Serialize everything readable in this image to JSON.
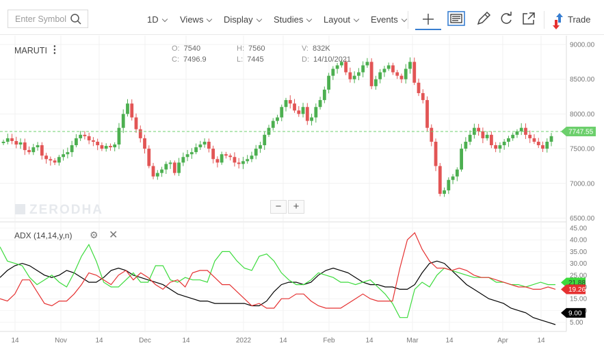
{
  "toolbar": {
    "search_placeholder": "Enter Symbol",
    "interval": "1D",
    "views": "Views",
    "display": "Display",
    "studies": "Studies",
    "layout": "Layout",
    "events": "Events",
    "trade": "Trade"
  },
  "header": {
    "symbol": "MARUTI",
    "o_label": "O:",
    "o_value": "7540",
    "c_label": "C:",
    "c_value": "7496.9",
    "h_label": "H:",
    "h_value": "7560",
    "l_label": "L:",
    "l_value": "7445",
    "v_label": "V:",
    "v_value": "832K",
    "date": "14/10/2021"
  },
  "watermark": "ZERODHA",
  "zoom": {
    "minus": "−",
    "plus": "+"
  },
  "indicator": {
    "label": "ADX (14,14,y,n)"
  },
  "colors": {
    "up": "#4caf50",
    "down": "#e25555",
    "adx": "#000000",
    "plus_di": "#3cdb3c",
    "minus_di": "#e53030",
    "last_price": "#6ccf6c"
  },
  "chart_data": [
    {
      "type": "candlestick",
      "symbol": "MARUTI",
      "ylim": [
        6500,
        9000
      ],
      "y_ticks": [
        "9000.00",
        "8500.00",
        "8000.00",
        "7500.00",
        "7000.00",
        "6500.00"
      ],
      "x_ticks": [
        "14",
        "Nov",
        "14",
        "Dec",
        "14",
        "2022",
        "14",
        "Feb",
        "14",
        "Mar",
        "14",
        "Apr",
        "14"
      ],
      "last_price": "7747.55",
      "close_series": [
        7600,
        7650,
        7610,
        7560,
        7590,
        7480,
        7450,
        7520,
        7550,
        7400,
        7350,
        7330,
        7300,
        7380,
        7420,
        7450,
        7550,
        7650,
        7700,
        7680,
        7620,
        7600,
        7550,
        7500,
        7540,
        7520,
        7560,
        7800,
        8000,
        8150,
        7950,
        7780,
        7650,
        7500,
        7250,
        7100,
        7150,
        7200,
        7280,
        7300,
        7150,
        7300,
        7380,
        7420,
        7450,
        7520,
        7560,
        7600,
        7500,
        7350,
        7300,
        7420,
        7400,
        7380,
        7300,
        7280,
        7320,
        7350,
        7400,
        7500,
        7550,
        7700,
        7800,
        7900,
        7950,
        8100,
        8200,
        8150,
        8050,
        8000,
        8100,
        7900,
        7950,
        8100,
        8200,
        8350,
        8550,
        8650,
        8700,
        8750,
        8600,
        8500,
        8550,
        8600,
        8700,
        8750,
        8400,
        8500,
        8600,
        8650,
        8700,
        8600,
        8550,
        8500,
        8650,
        8750,
        8450,
        8300,
        8200,
        7800,
        7600,
        7250,
        6850,
        6900,
        7050,
        7100,
        7200,
        7500,
        7600,
        7700,
        7800,
        7750,
        7650,
        7700,
        7550,
        7500,
        7550,
        7600,
        7650,
        7700,
        7750,
        7800,
        7700,
        7650,
        7600,
        7550,
        7500,
        7600,
        7680
      ],
      "ohlc_hover": {
        "open": 7540,
        "high": 7560,
        "low": 7445,
        "close": 7496.9,
        "volume": "832K",
        "date": "14/10/2021"
      }
    },
    {
      "type": "line",
      "title": "ADX (14,14,y,n)",
      "ylim": [
        0,
        45
      ],
      "y_ticks": [
        "45.00",
        "40.00",
        "35.00",
        "30.00",
        "25.00",
        "20.00",
        "15.00",
        "10.00",
        "5.00"
      ],
      "last_values": {
        "adx": "9.00",
        "plus_di": "21.88",
        "minus_di": "19.26"
      },
      "series": [
        {
          "key": "adx",
          "values": [
            24,
            27,
            29,
            30,
            29,
            27,
            25,
            24,
            25,
            27,
            26,
            24,
            22,
            22,
            24,
            27,
            28,
            27,
            25,
            24,
            23,
            22,
            21,
            19,
            17,
            16,
            15,
            14,
            14,
            13,
            13,
            13,
            13,
            13,
            12,
            12,
            14,
            18,
            21,
            22,
            22,
            21,
            22,
            25,
            27,
            28,
            27,
            26,
            24,
            22,
            21,
            21,
            20,
            20,
            19,
            19,
            21,
            26,
            30,
            31,
            30,
            27,
            24,
            21,
            19,
            17,
            15,
            14,
            13,
            11,
            10,
            9,
            7,
            6,
            5,
            4
          ]
        },
        {
          "key": "plus_di",
          "values": [
            37,
            31,
            30,
            29,
            24,
            21,
            23,
            25,
            22,
            20,
            26,
            33,
            38,
            31,
            22,
            20,
            20,
            23,
            26,
            22,
            22,
            29,
            29,
            23,
            22,
            24,
            23,
            23,
            22,
            31,
            35,
            35,
            31,
            28,
            27,
            33,
            34,
            31,
            26,
            23,
            21,
            21,
            23,
            26,
            25,
            24,
            22,
            22,
            21,
            22,
            23,
            20,
            17,
            13,
            7,
            7,
            19,
            22,
            20,
            25,
            28,
            27,
            26,
            25,
            24,
            24,
            24,
            22,
            22,
            21,
            21,
            20,
            21,
            22,
            21,
            21
          ]
        },
        {
          "key": "minus_di",
          "values": [
            15,
            14,
            17,
            23,
            23,
            18,
            13,
            12,
            14,
            14,
            17,
            21,
            26,
            25,
            23,
            21,
            25,
            27,
            23,
            26,
            24,
            21,
            19,
            22,
            23,
            20,
            26,
            27,
            27,
            24,
            21,
            21,
            18,
            15,
            12,
            13,
            11,
            11,
            15,
            15,
            17,
            17,
            14,
            12,
            11,
            11,
            11,
            13,
            15,
            17,
            15,
            14,
            14,
            14,
            28,
            40,
            43,
            36,
            31,
            28,
            28,
            27,
            28,
            27,
            25,
            24,
            24,
            23,
            22,
            21,
            20,
            20,
            19,
            19,
            20,
            19
          ]
        }
      ]
    }
  ]
}
